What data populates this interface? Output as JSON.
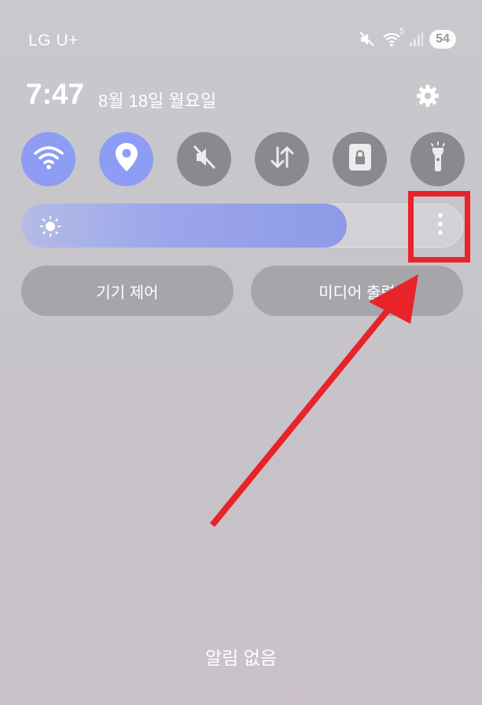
{
  "status_bar": {
    "carrier": "LG U+",
    "network_label": "5",
    "battery": "54",
    "icons": [
      "mute-icon",
      "wifi-icon",
      "signal-icon",
      "battery-icon"
    ]
  },
  "header": {
    "time": "7:47",
    "date": "8월 18일 월요일",
    "settings_icon": "gear-icon"
  },
  "quick_settings": [
    {
      "icon": "wifi-icon",
      "state": "on"
    },
    {
      "icon": "location-icon",
      "state": "on"
    },
    {
      "icon": "mute-icon",
      "state": "off"
    },
    {
      "icon": "data-transfer-icon",
      "state": "off"
    },
    {
      "icon": "lock-icon",
      "state": "off"
    },
    {
      "icon": "flashlight-icon",
      "state": "off"
    }
  ],
  "brightness": {
    "level": 0.74,
    "icon": "sun-icon",
    "more_icon": "more-vertical-icon"
  },
  "buttons": {
    "device_control": "기기 제어",
    "media_output": "미디어 출력"
  },
  "notifications": {
    "empty_text": "알림 없음"
  },
  "colors": {
    "active_tile": "#8e9df4",
    "inactive_tile": "#8a898e",
    "annotation": "#e8232a"
  }
}
